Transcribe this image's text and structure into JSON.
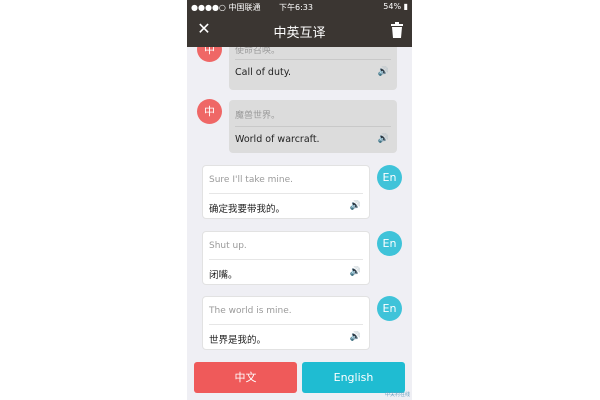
{
  "status_bar": {
    "carrier": "●●●●○ 中国联通",
    "time": "下午6:33",
    "battery": "54%"
  },
  "nav": {
    "title": "中英互译",
    "close_icon": "close-icon",
    "trash_icon": "trash-icon"
  },
  "messages": [
    {
      "lang_badge": "中",
      "source": "使命召唤。",
      "translation": "Call of duty."
    },
    {
      "lang_badge": "中",
      "source": "魔兽世界。",
      "translation": "World of warcraft."
    },
    {
      "lang_badge": "En",
      "source": "Sure I'll take mine.",
      "translation": "确定我要带我的。"
    },
    {
      "lang_badge": "En",
      "source": "Shut up.",
      "translation": "闭嘴。"
    },
    {
      "lang_badge": "En",
      "source": "The world is mine.",
      "translation": "世界是我的。"
    }
  ],
  "speaker_glyph": "🔊",
  "buttons": {
    "chinese": "中文",
    "english": "English"
  },
  "watermark": "中关村在线",
  "colors": {
    "nav_bg": "#3b3632",
    "zh_accent": "#ef5a5a",
    "en_accent": "#1fbcd2"
  }
}
